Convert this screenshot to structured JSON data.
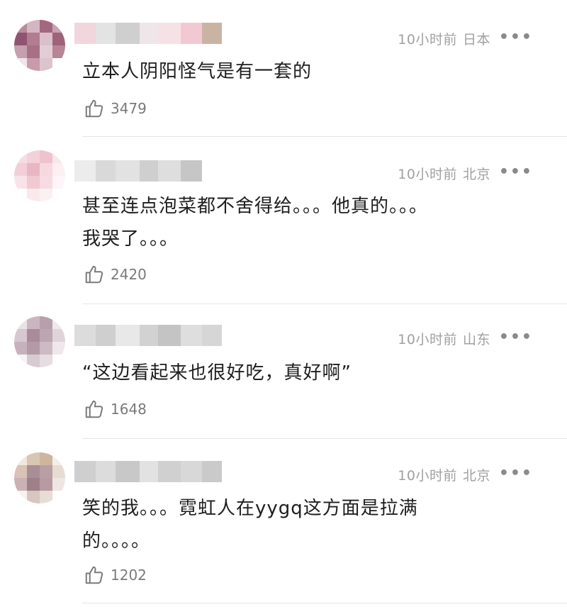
{
  "comments": [
    {
      "time": "10小时前",
      "location": "日本",
      "more": "•••",
      "text_lines": [
        "立本人阴阳怪气是有一套的"
      ],
      "likes": "3479",
      "avatar_colors": [
        "#b98a9c",
        "#d4b6c2",
        "#a3687f",
        "#c9a2b1",
        "#8f5570",
        "#b37d91",
        "#d9c0ca",
        "#9e6378",
        "#c5a0ae",
        "#a87085",
        "#e2cdd5",
        "#b88596",
        "#f0e4e8",
        "#c99aab",
        "#dcc4cd",
        "#ffffff"
      ],
      "name_colors": [
        "#f2d6de",
        "#e3e3e3",
        "#cfcfcf",
        "#eee6e9",
        "#f6e1e6",
        "#f2c9d2",
        "#c9b4a4"
      ]
    },
    {
      "time": "10小时前",
      "location": "北京",
      "more": "•••",
      "text_lines": [
        "甚至连点泡菜都不舍得给。。。他真的。。。",
        "我哭了。。。"
      ],
      "likes": "2420",
      "avatar_colors": [
        "#f6dde3",
        "#f3d1d9",
        "#eec3cd",
        "#f7e6ea",
        "#f2cfd7",
        "#e9b6c3",
        "#f5d9df",
        "#fbeff2",
        "#f8e3e8",
        "#f0cad3",
        "#f6dce2",
        "#fdf5f7",
        "#ffffff",
        "#f9e9ec",
        "#fbf0f2",
        "#ffffff"
      ],
      "name_colors": [
        "#ececec",
        "#d9d9d9",
        "#e2e2e2",
        "#cfcfcf",
        "#dedede",
        "#c6c6c6"
      ]
    },
    {
      "time": "10小时前",
      "location": "山东",
      "more": "•••",
      "text_lines": [
        "“这边看起来也很好吃，真好啊”"
      ],
      "likes": "1648",
      "avatar_colors": [
        "#e9e3e6",
        "#c9b6bf",
        "#b7a0ac",
        "#efe9ec",
        "#d7c7cf",
        "#a98b9a",
        "#bda5b1",
        "#e0d3d9",
        "#c7b2bc",
        "#b49aa7",
        "#cdbac3",
        "#efe7eb",
        "#f7f3f5",
        "#d8cad1",
        "#e6dce1",
        "#ffffff"
      ],
      "name_colors": [
        "#dcdcdc",
        "#cfcfcf",
        "#e8e8e8",
        "#d2d2d2",
        "#c4c4c4",
        "#dedede",
        "#d6d6d6"
      ]
    },
    {
      "time": "10小时前",
      "location": "北京",
      "more": "•••",
      "text_lines": [
        "笑的我。。。霓虹人在yygq这方面是拉满",
        "的。。。。"
      ],
      "likes": "1202",
      "avatar_colors": [
        "#efe8df",
        "#d8c6b3",
        "#cfb59d",
        "#f3eee8",
        "#d9c2b6",
        "#a98f95",
        "#b79fa4",
        "#e6dcd2",
        "#c9b1b4",
        "#9f7f8a",
        "#b89aa3",
        "#eee6e2",
        "#f6f2ee",
        "#d7c5bf",
        "#e7dcd6",
        "#ffffff"
      ],
      "name_colors": [
        "#cfcfcf",
        "#dcdcdc",
        "#c8c8c8",
        "#e2e2e2",
        "#d0d0d0",
        "#d8d8d8",
        "#cacaca"
      ]
    }
  ]
}
